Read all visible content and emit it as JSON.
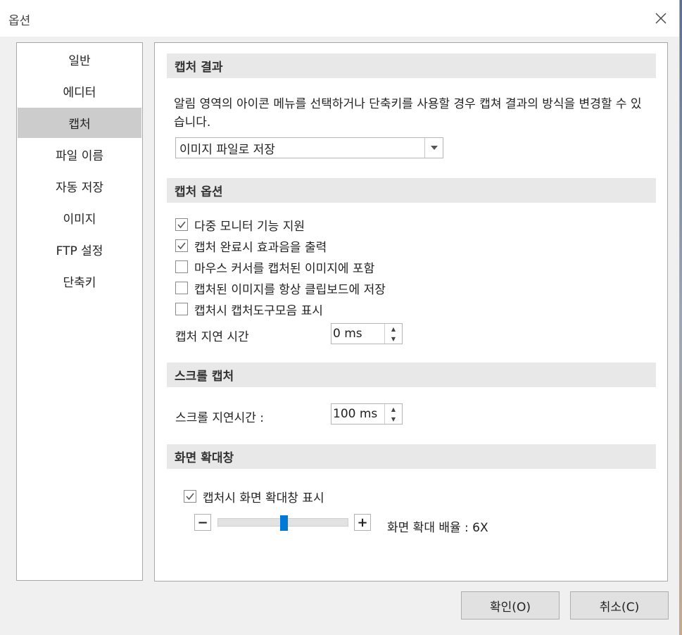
{
  "window": {
    "title": "옵션"
  },
  "sidebar": {
    "items": [
      {
        "label": "일반"
      },
      {
        "label": "에디터"
      },
      {
        "label": "캡처",
        "active": true
      },
      {
        "label": "파일 이름"
      },
      {
        "label": "자동 저장"
      },
      {
        "label": "이미지"
      },
      {
        "label": "FTP 설정"
      },
      {
        "label": "단축키"
      }
    ]
  },
  "capture_result": {
    "header": "캡처 결과",
    "description": "알림 영역의 아이콘 메뉴를 선택하거나 단축키를 사용할 경우 캡쳐 결과의 방식을 변경할 수 있습니다.",
    "selected": "이미지 파일로 저장"
  },
  "capture_options": {
    "header": "캡처 옵션",
    "checkboxes": [
      {
        "label": "다중 모니터 기능 지원",
        "checked": true
      },
      {
        "label": "캡처 완료시 효과음을 출력",
        "checked": true
      },
      {
        "label": "마우스 커서를 캡처된 이미지에 포함",
        "checked": false
      },
      {
        "label": "캡처된 이미지를 항상 클립보드에 저장",
        "checked": false
      },
      {
        "label": "캡처시 캡처도구모음 표시",
        "checked": false
      }
    ],
    "delay_label": "캡처 지연 시간",
    "delay_value": "0 ms"
  },
  "scroll_capture": {
    "header": "스크롤 캡처",
    "delay_label": "스크롤 지연시간 :",
    "delay_value": "100 ms"
  },
  "magnifier": {
    "header": "화면 확대창",
    "checkbox": {
      "label": "캡처시 화면 확대창 표시",
      "checked": true
    },
    "zoom_label": "화면 확대 배율 : 6X",
    "slider_fraction": 0.5,
    "minus": "−",
    "plus": "+"
  },
  "buttons": {
    "ok": "확인(O)",
    "cancel": "취소(C)"
  },
  "icons": {
    "close": "close-icon",
    "dropdown": "chevron-down-icon",
    "check": "check-icon"
  }
}
